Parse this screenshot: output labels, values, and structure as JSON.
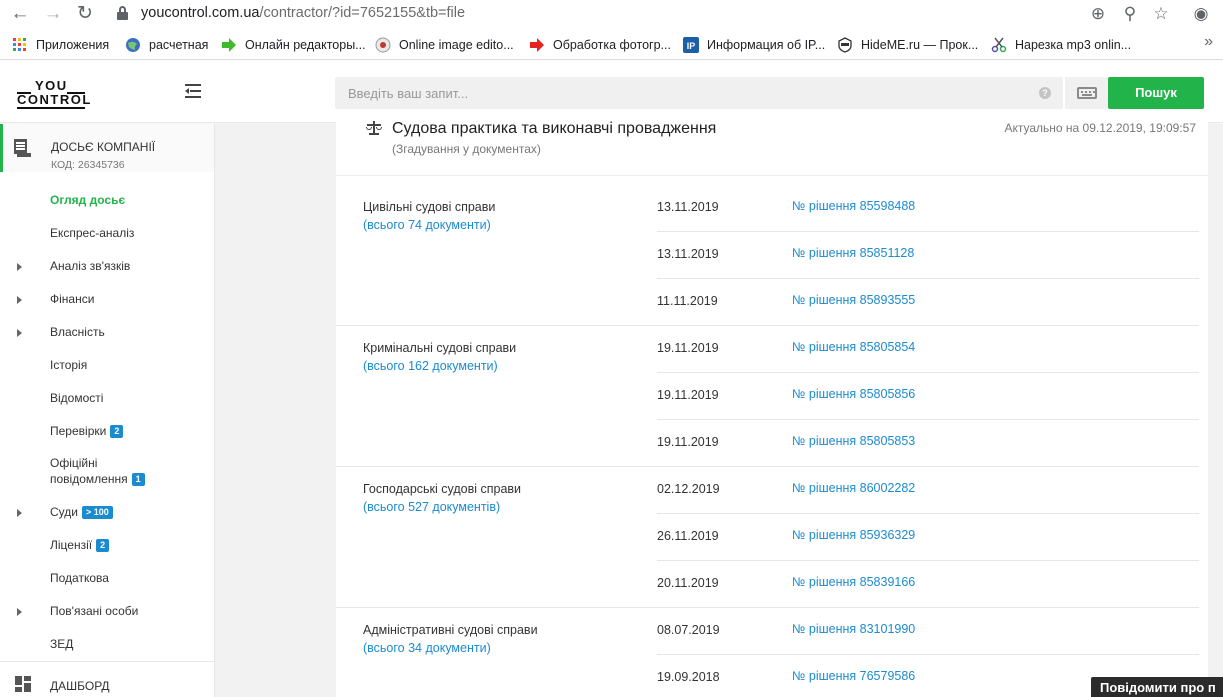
{
  "browser": {
    "url_host": "youcontrol.com.ua",
    "url_path": "/contractor/?id=7652155&tb=file",
    "bookmarks": [
      {
        "label": "Приложения",
        "icon": "apps-grid-icon"
      },
      {
        "label": "расчетная",
        "icon": "globe-icon"
      },
      {
        "label": "Онлайн редакторы...",
        "icon": "green-arrow-icon"
      },
      {
        "label": "Online image edito...",
        "icon": "image-editor-icon"
      },
      {
        "label": "Обработка фотогр...",
        "icon": "red-arrow-icon"
      },
      {
        "label": "Информация об IP...",
        "icon": "ip-icon"
      },
      {
        "label": "HideME.ru — Прок...",
        "icon": "ninja-icon"
      },
      {
        "label": "Нарезка mp3 onlin...",
        "icon": "scissors-icon"
      }
    ]
  },
  "header": {
    "logo_top": "YOU",
    "logo_bottom": "CONTROL",
    "search_placeholder": "Введіть ваш запит...",
    "help": "?",
    "search_button": "Пошук"
  },
  "sidebar": {
    "dossier_title": "ДОСЬЄ КОМПАНІЇ",
    "dossier_code": "КОД: 26345736",
    "items": [
      {
        "label": "Огляд досьє",
        "active": true,
        "arrow": false,
        "badge": ""
      },
      {
        "label": "Експрес-аналіз",
        "active": false,
        "arrow": false,
        "badge": ""
      },
      {
        "label": "Аналіз зв'язків",
        "active": false,
        "arrow": true,
        "badge": ""
      },
      {
        "label": "Фінанси",
        "active": false,
        "arrow": true,
        "badge": ""
      },
      {
        "label": "Власність",
        "active": false,
        "arrow": true,
        "badge": ""
      },
      {
        "label": "Історія",
        "active": false,
        "arrow": false,
        "badge": ""
      },
      {
        "label": "Відомості",
        "active": false,
        "arrow": false,
        "badge": ""
      },
      {
        "label": "Перевірки",
        "active": false,
        "arrow": false,
        "badge": "2"
      },
      {
        "label": "Офіційні",
        "label2": "повідомлення",
        "active": false,
        "arrow": false,
        "badge": "1"
      },
      {
        "label": "Суди",
        "active": false,
        "arrow": true,
        "badge": "> 100"
      },
      {
        "label": "Ліцензії",
        "active": false,
        "arrow": false,
        "badge": "2"
      },
      {
        "label": "Податкова",
        "active": false,
        "arrow": false,
        "badge": ""
      },
      {
        "label": "Пов'язані особи",
        "active": false,
        "arrow": true,
        "badge": ""
      },
      {
        "label": "ЗЕД",
        "active": false,
        "arrow": false,
        "badge": ""
      }
    ],
    "dashboard": "ДАШБОРД"
  },
  "section": {
    "title": "Судова практика та виконавчі провадження",
    "subtitle": "(Згадування у документах)",
    "actual": "Актуально на 09.12.2019, 19:09:57",
    "categories": [
      {
        "name": "Цивільні судові справи",
        "total": "(всього 74 документи)",
        "rows": [
          {
            "date": "13.11.2019",
            "link": "№ рішення 85598488"
          },
          {
            "date": "13.11.2019",
            "link": "№ рішення 85851128"
          },
          {
            "date": "11.11.2019",
            "link": "№ рішення 85893555"
          }
        ]
      },
      {
        "name": "Кримінальні судові справи",
        "total": "(всього 162 документи)",
        "rows": [
          {
            "date": "19.11.2019",
            "link": "№ рішення 85805854"
          },
          {
            "date": "19.11.2019",
            "link": "№ рішення 85805856"
          },
          {
            "date": "19.11.2019",
            "link": "№ рішення 85805853"
          }
        ]
      },
      {
        "name": "Господарські судові справи",
        "total": "(всього 527 документів)",
        "rows": [
          {
            "date": "02.12.2019",
            "link": "№ рішення 86002282"
          },
          {
            "date": "26.11.2019",
            "link": "№ рішення 85936329"
          },
          {
            "date": "20.11.2019",
            "link": "№ рішення 85839166"
          }
        ]
      },
      {
        "name": "Адміністративні судові справи",
        "total": "(всього 34 документи)",
        "rows": [
          {
            "date": "08.07.2019",
            "link": "№ рішення 83101990"
          },
          {
            "date": "19.09.2018",
            "link": "№ рішення 76579586"
          }
        ]
      }
    ]
  },
  "report_button": "Повідомити про п",
  "colors": {
    "accent_green": "#23b34b",
    "link_blue": "#1b8bd0",
    "badge_blue": "#1b8bd0"
  }
}
